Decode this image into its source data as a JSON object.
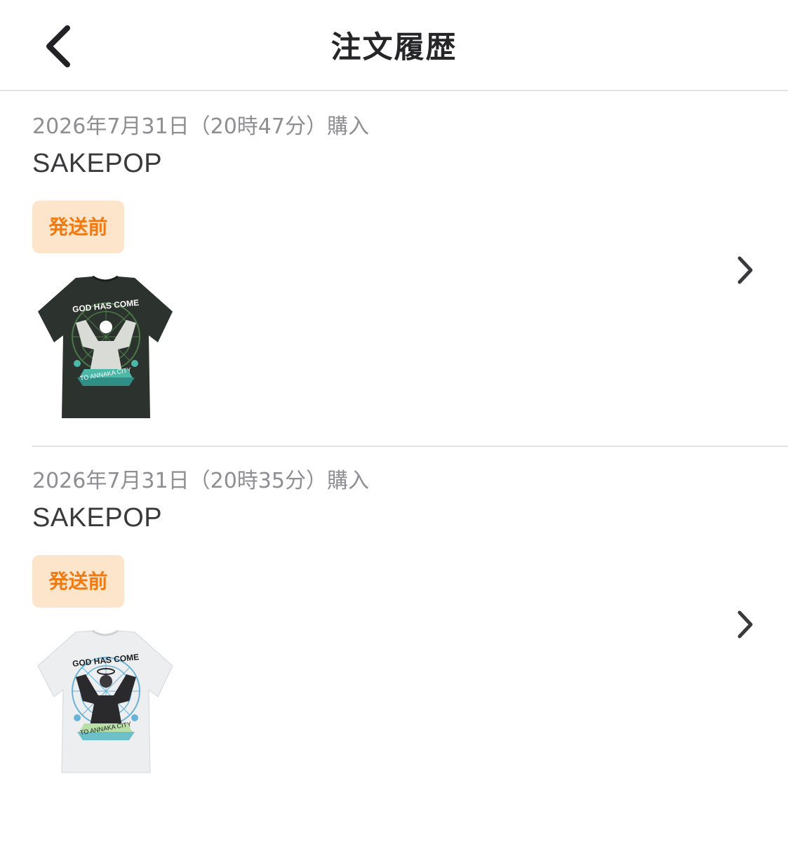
{
  "header": {
    "title": "注文履歴",
    "back_icon": "chevron-left-icon"
  },
  "orders": [
    {
      "date": "2026年7月31日（20時47分）購入",
      "shop": "SAKEPOP",
      "status": "発送前",
      "product": {
        "shirt_color": "#2c322d",
        "print_top": "GOD HAS COME",
        "print_bottom": "TO ANNAKA CITY"
      }
    },
    {
      "date": "2026年7月31日（20時35分）購入",
      "shop": "SAKEPOP",
      "status": "発送前",
      "product": {
        "shirt_color": "#eceef0",
        "print_top": "GOD HAS COME",
        "print_bottom": "TO ANNAKA CITY"
      }
    }
  ],
  "colors": {
    "status_badge_bg": "#fde5cc",
    "status_badge_text": "#f07a12",
    "date_text": "#8e8e93",
    "divider": "#e3e3e6"
  }
}
